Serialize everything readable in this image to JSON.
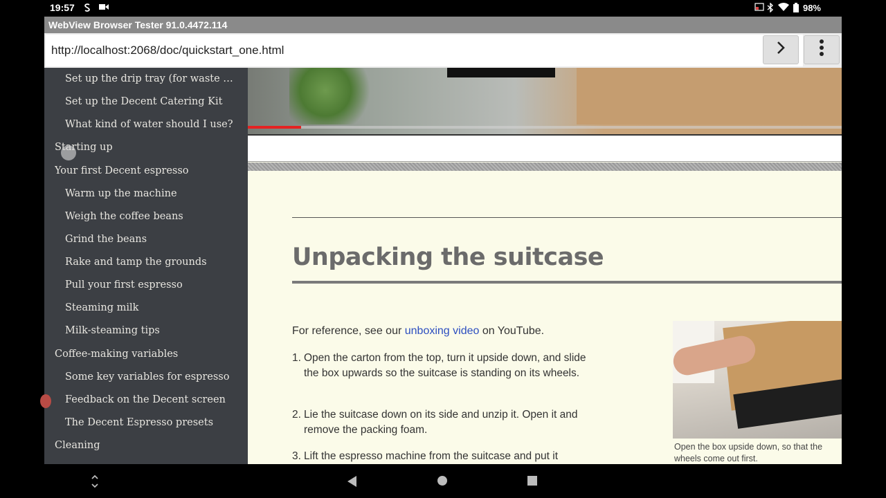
{
  "status_bar": {
    "time": "19:57",
    "battery": "98%",
    "left_icons": [
      "s-icon",
      "video-icon"
    ],
    "right_icons": [
      "cast-icon",
      "bluetooth-icon",
      "wifi-icon",
      "battery-icon"
    ]
  },
  "app": {
    "title": "WebView Browser Tester 91.0.4472.114"
  },
  "url_bar": {
    "value": "http://localhost:2068/doc/quickstart_one.html",
    "go_icon": "›",
    "menu_icon": "⋮"
  },
  "sidebar": {
    "items": [
      {
        "label": "Set up the drip tray (for waste w...",
        "level": 2
      },
      {
        "label": "Set up the Decent Catering Kit",
        "level": 2
      },
      {
        "label": "What kind of water should I use?",
        "level": 2
      },
      {
        "label": "Starting up",
        "level": 1
      },
      {
        "label": "Your first Decent espresso",
        "level": 1
      },
      {
        "label": "Warm up the machine",
        "level": 2
      },
      {
        "label": "Weigh the coffee beans",
        "level": 2
      },
      {
        "label": "Grind the beans",
        "level": 2
      },
      {
        "label": "Rake and tamp the grounds",
        "level": 2
      },
      {
        "label": "Pull your first espresso",
        "level": 2
      },
      {
        "label": "Steaming milk",
        "level": 2
      },
      {
        "label": "Milk-steaming tips",
        "level": 2
      },
      {
        "label": "Coffee-making variables",
        "level": 1
      },
      {
        "label": "Some key variables for espresso",
        "level": 2
      },
      {
        "label": "Feedback on the Decent screen",
        "level": 2
      },
      {
        "label": "The Decent Espresso presets",
        "level": 2
      },
      {
        "label": "Cleaning",
        "level": 1
      }
    ]
  },
  "content": {
    "heading": "Unpacking the suitcase",
    "intro_before": "For reference, see our ",
    "intro_link": "unboxing video",
    "intro_after": " on YouTube.",
    "steps": [
      {
        "num": "1.",
        "text": "Open the carton from the top, turn it upside down, and slide the box upwards so the suitcase is standing on its wheels."
      },
      {
        "num": "2.",
        "text": "Lie the suitcase down on its side and unzip it. Open it and remove the packing foam."
      },
      {
        "num": "3.",
        "text": "Lift the espresso machine from the suitcase and put it"
      }
    ],
    "photo_caption": "Open the box upside down, so that the wheels come out first.",
    "video_progress": 0.09
  },
  "nav_bar": {
    "icons": [
      "rotate-icon",
      "back-icon",
      "home-icon",
      "recents-icon"
    ]
  }
}
